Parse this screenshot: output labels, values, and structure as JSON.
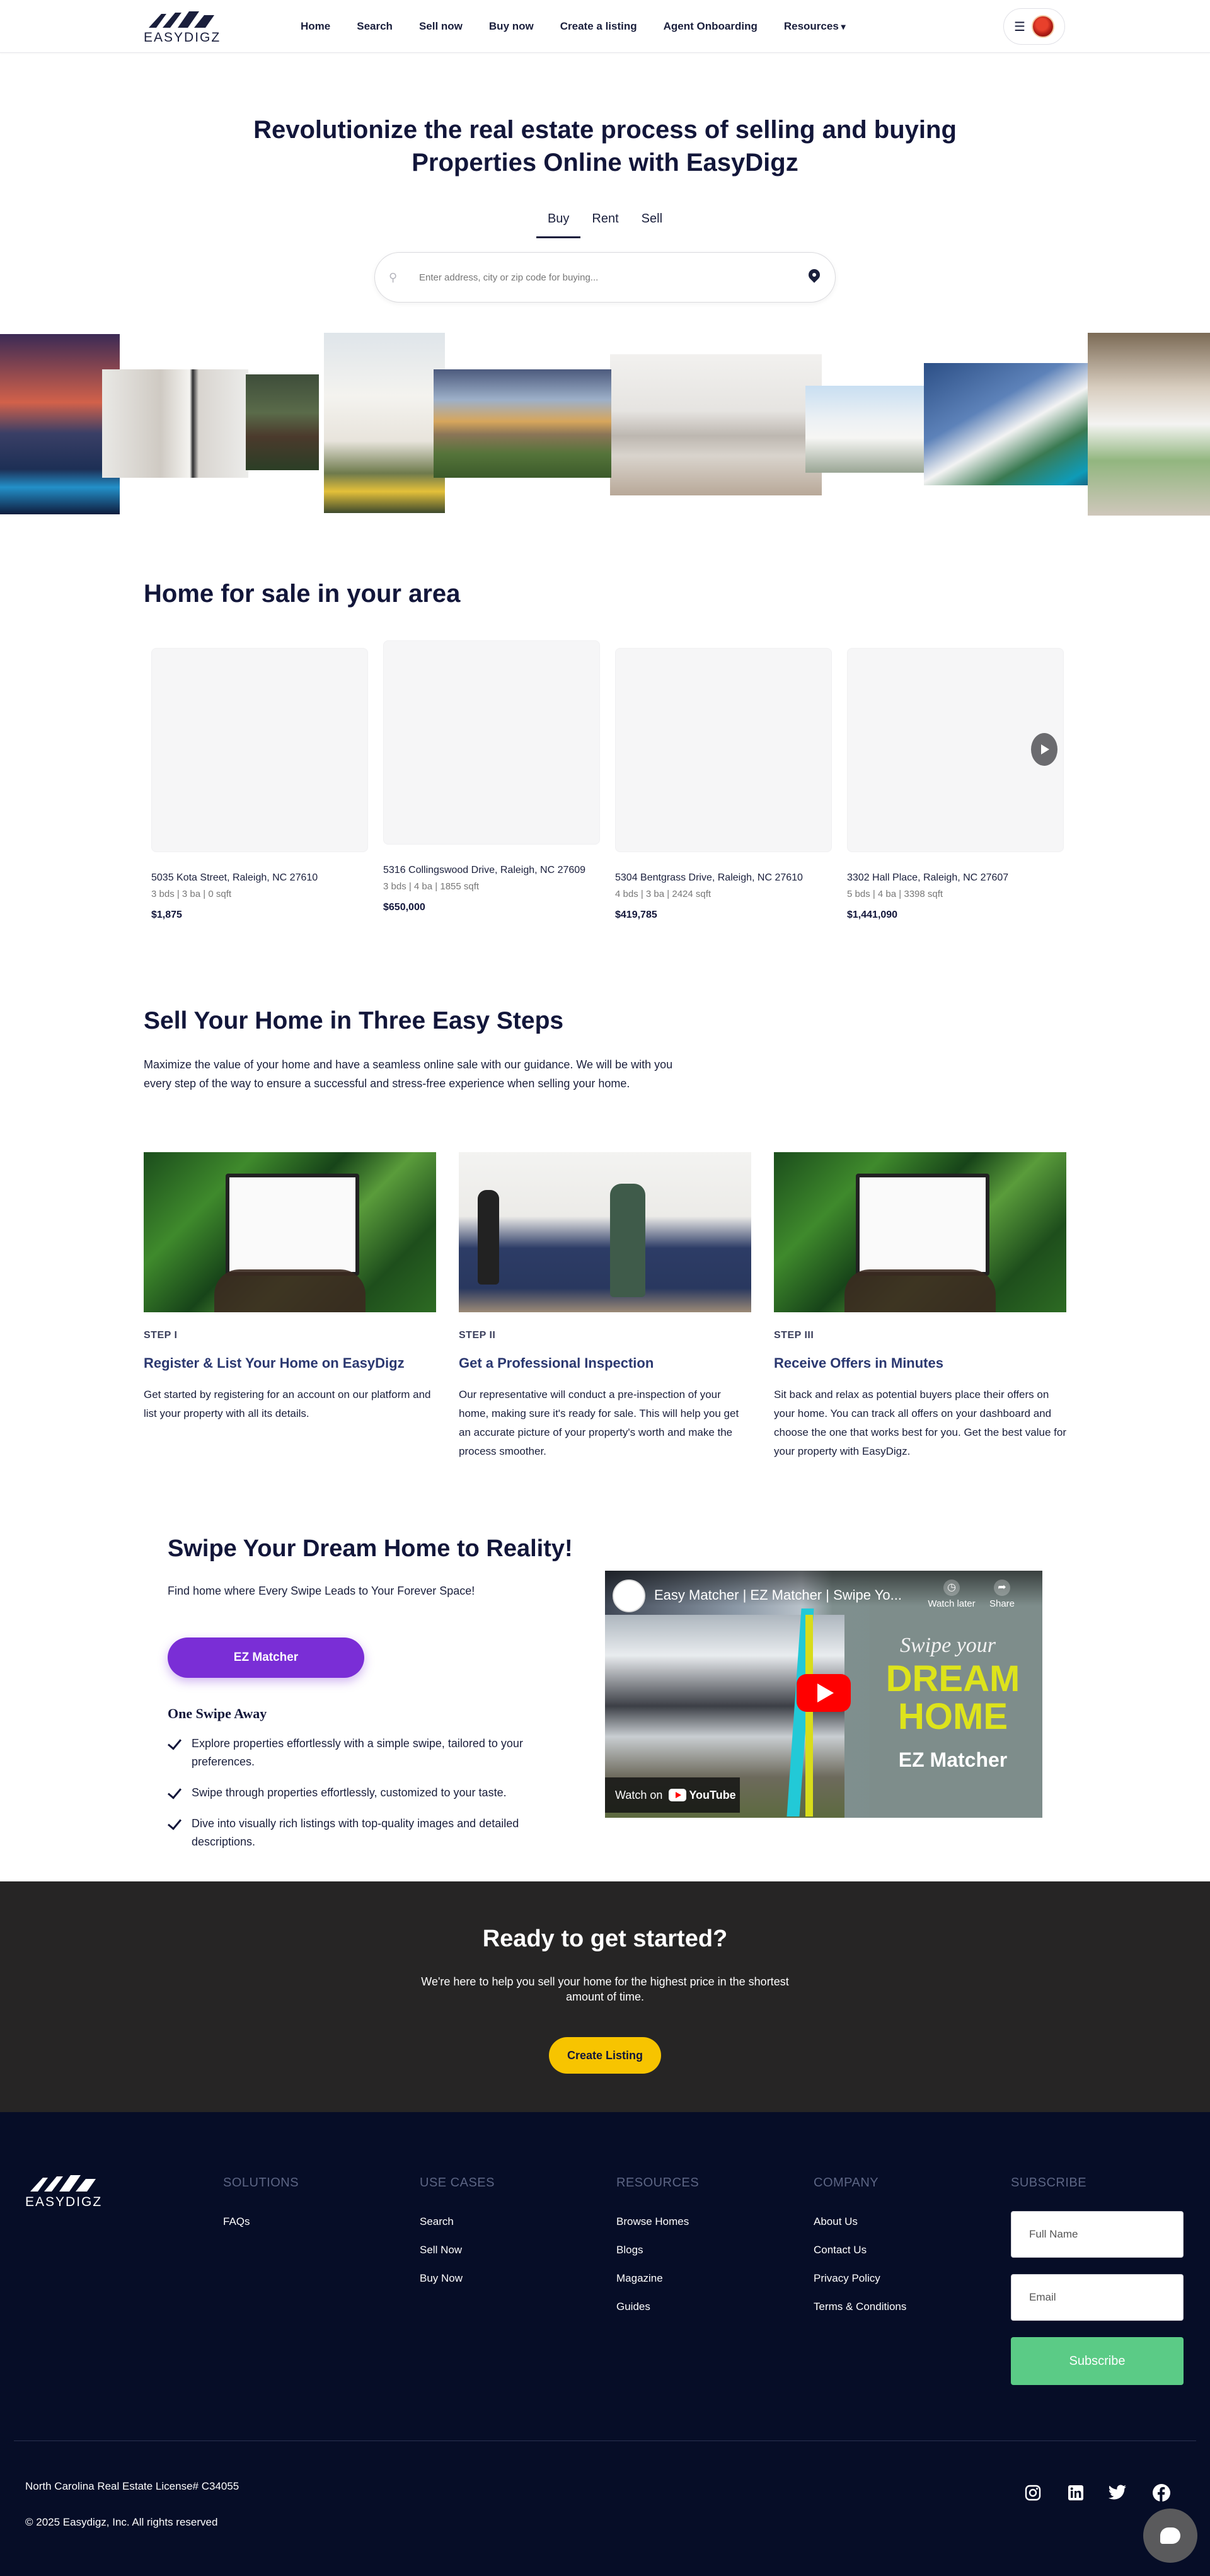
{
  "nav": {
    "logo_text": "EASYDIGZ",
    "links": [
      "Home",
      "Search",
      "Sell now",
      "Buy now",
      "Create a listing",
      "Agent Onboarding",
      "Resources"
    ]
  },
  "hero": {
    "title_line1": "Revolutionize the real estate process of selling and buying",
    "title_line2": "Properties Online with EasyDigz",
    "tabs": [
      "Buy",
      "Rent",
      "Sell"
    ],
    "active_tab": "Buy",
    "search_placeholder": "Enter address, city or zip code for buying..."
  },
  "listings": {
    "title": "Home for sale in your area",
    "items": [
      {
        "address": "5035 Kota Street, Raleigh, NC 27610",
        "meta": "3 bds | 3 ba | 0 sqft",
        "price": "$1,875"
      },
      {
        "address": "5316 Collingswood Drive, Raleigh, NC 27609",
        "meta": "3 bds | 4 ba | 1855 sqft",
        "price": "$650,000"
      },
      {
        "address": "5304 Bentgrass Drive, Raleigh, NC 27610",
        "meta": "4 bds | 3 ba | 2424 sqft",
        "price": "$419,785"
      },
      {
        "address": "3302 Hall Place, Raleigh, NC 27607",
        "meta": "5 bds | 4 ba | 3398 sqft",
        "price": "$1,441,090"
      }
    ]
  },
  "steps": {
    "title": "Sell Your Home in Three Easy Steps",
    "intro": "Maximize the value of your home and have a seamless online sale with our guidance. We will be with you every step of the way to ensure a successful and stress-free experience when selling your home.",
    "items": [
      {
        "num": "STEP I",
        "heading": "Register & List Your Home on EasyDigz",
        "body": "Get started by registering for an account on our platform and list your property with all its details."
      },
      {
        "num": "STEP II",
        "heading": "Get a Professional Inspection",
        "body": "Our representative will conduct a pre-inspection of your home, making sure it's ready for sale. This will help you get an accurate picture of your property's worth and make the process smoother."
      },
      {
        "num": "STEP III",
        "heading": "Receive Offers in Minutes",
        "body": "Sit back and relax as potential buyers place their offers on your home. You can track all offers on your dashboard and choose the one that works best for you. Get the best value for your property with EasyDigz."
      }
    ]
  },
  "swipe": {
    "title": "Swipe Your Dream Home to Reality!",
    "subtitle": "Find home where Every Swipe Leads to Your Forever Space!",
    "button": "EZ Matcher",
    "list_title": "One Swipe Away",
    "points": [
      "Explore properties effortlessly with a simple swipe, tailored to your preferences.",
      "Swipe through properties effortlessly, customized to your taste.",
      "Dive into visually rich listings with top-quality images and detailed descriptions."
    ],
    "video": {
      "title": "Easy Matcher | EZ Matcher | Swipe Yo...",
      "watch_later": "Watch later",
      "share": "Share",
      "overlay_swipe": "Swipe your",
      "overlay_dream": "DREAM HOME",
      "overlay_brand": "EZ Matcher",
      "watch_on": "Watch on",
      "youtube": "YouTube"
    }
  },
  "cta": {
    "title": "Ready to get started?",
    "subtitle": "We're here to help you sell your home for the highest price in the shortest amount of time.",
    "button": "Create Listing"
  },
  "footer": {
    "logo_text": "EASYDIGZ",
    "columns": [
      {
        "heading": "SOLUTIONS",
        "links": [
          "FAQs"
        ]
      },
      {
        "heading": "USE CASES",
        "links": [
          "Search",
          "Sell Now",
          "Buy Now"
        ]
      },
      {
        "heading": "RESOURCES",
        "links": [
          "Browse Homes",
          "Blogs",
          "Magazine",
          "Guides"
        ]
      },
      {
        "heading": "COMPANY",
        "links": [
          "About Us",
          "Contact Us",
          "Privacy Policy",
          "Terms & Conditions"
        ]
      }
    ],
    "subscribe": {
      "heading": "SUBSCRIBE",
      "name_placeholder": "Full Name",
      "email_placeholder": "Email",
      "button": "Subscribe"
    },
    "license": "North Carolina Real Estate License# C34055",
    "copyright": "© 2025 Easydigz, Inc. All rights reserved",
    "social": [
      "instagram-icon",
      "linkedin-icon",
      "twitter-icon",
      "facebook-icon"
    ]
  },
  "colors": {
    "navy": "#12163a",
    "purple": "#7a2ed6",
    "yellow": "#f7c400",
    "green": "#5bcb86",
    "footer_bg": "#060d27",
    "cta_bg": "#262525"
  }
}
